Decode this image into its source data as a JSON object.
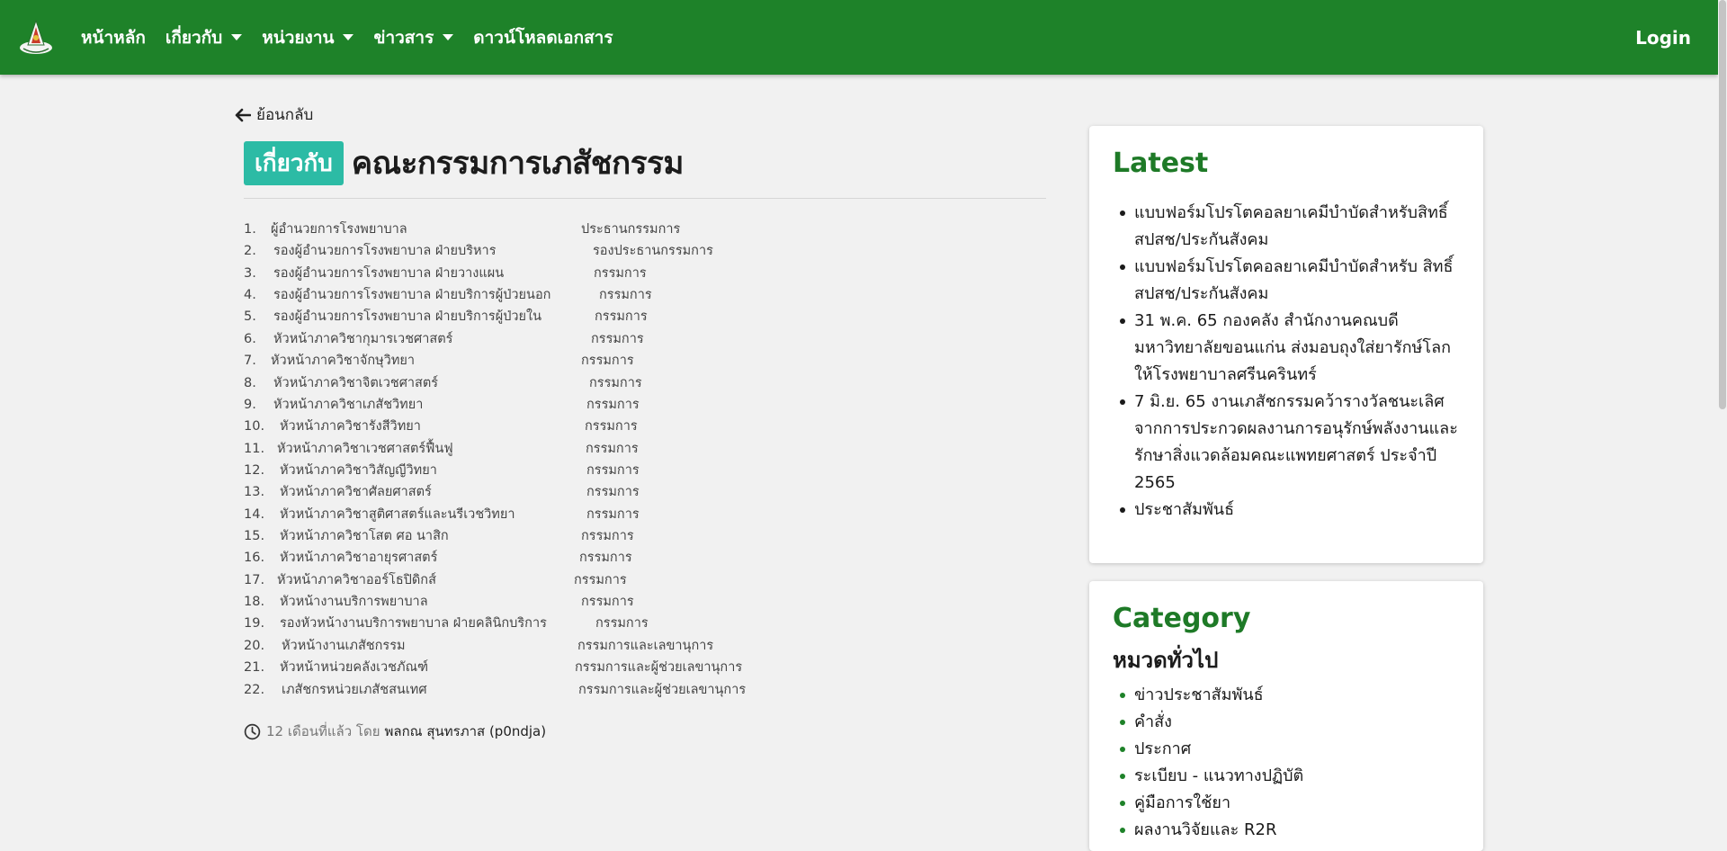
{
  "nav": {
    "home": "หน้าหลัก",
    "about": "เกี่ยวกับ",
    "units": "หน่วยงาน",
    "news": "ข่าวสาร",
    "downloads": "ดาวน์โหลดเอกสาร",
    "login": "Login"
  },
  "back_label": "ย้อนกลับ",
  "badge": "เกี่ยวกับ",
  "page_title": "คณะกรรมการเภสัชกรรม",
  "members": [
    {
      "num": "1.",
      "name": "ผู้อำนวยการโรงพยาบาล",
      "role": "ประธานกรรมการ"
    },
    {
      "num": "2.",
      "name": "รองผู้อำนวยการโรงพยาบาล ฝ่ายบริหาร",
      "role": "รองประธานกรรมการ"
    },
    {
      "num": "3.",
      "name": "รองผู้อำนวยการโรงพยาบาล ฝ่ายวางแผน",
      "role": "กรรมการ"
    },
    {
      "num": "4.",
      "name": "รองผู้อำนวยการโรงพยาบาล ฝ่ายบริการผู้ป่วยนอก",
      "role": "กรรมการ"
    },
    {
      "num": "5.",
      "name": "รองผู้อำนวยการโรงพยาบาล ฝ่ายบริการผู้ป่วยใน",
      "role": "กรรมการ"
    },
    {
      "num": "6.",
      "name": "หัวหน้าภาควิชากุมารเวชศาสตร์",
      "role": "กรรมการ"
    },
    {
      "num": "7.",
      "name": "หัวหน้าภาควิชาจักษุวิทยา",
      "role": "กรรมการ"
    },
    {
      "num": "8.",
      "name": "หัวหน้าภาควิชาจิตเวชศาสตร์",
      "role": "กรรมการ"
    },
    {
      "num": "9.",
      "name": "หัวหน้าภาควิชาเภสัชวิทยา",
      "role": "กรรมการ"
    },
    {
      "num": "10.",
      "name": "หัวหน้าภาควิชารังสีวิทยา",
      "role": "กรรมการ"
    },
    {
      "num": "11.",
      "name": "หัวหน้าภาควิชาเวชศาสตร์ฟื้นฟู",
      "role": "กรรมการ"
    },
    {
      "num": "12.",
      "name": "หัวหน้าภาควิชาวิสัญญีวิทยา",
      "role": "กรรมการ"
    },
    {
      "num": "13.",
      "name": "หัวหน้าภาควิชาศัลยศาสตร์",
      "role": "กรรมการ"
    },
    {
      "num": "14.",
      "name": "หัวหน้าภาควิชาสูติศาสตร์และนรีเวชวิทยา",
      "role": "กรรมการ"
    },
    {
      "num": "15.",
      "name": "หัวหน้าภาควิชาโสต ศอ นาสิก",
      "role": "กรรมการ"
    },
    {
      "num": "16.",
      "name": "หัวหน้าภาควิชาอายุรศาสตร์",
      "role": "กรรมการ"
    },
    {
      "num": "17.",
      "name": "หัวหน้าภาควิชาออร์โธปิดิกส์",
      "role": "กรรมการ"
    },
    {
      "num": "18.",
      "name": "หัวหน้างานบริการพยาบาล",
      "role": "กรรมการ"
    },
    {
      "num": "19.",
      "name": "รองหัวหน้างานบริการพยาบาล ฝ่ายคลินิกบริการ",
      "role": "กรรมการ"
    },
    {
      "num": "20.",
      "name": "หัวหน้างานเภสัชกรรม",
      "role": "กรรมการและเลขานุการ"
    },
    {
      "num": "21.",
      "name": "หัวหน้าหน่วยคลังเวชภัณฑ์",
      "role": "กรรมการและผู้ช่วยเลขานุการ"
    },
    {
      "num": "22.",
      "name": "เภสัชกรหน่วยเภสัชสนเทศ",
      "role": "กรรมการและผู้ช่วยเลขานุการ"
    }
  ],
  "meta": {
    "time": "12 เดือนที่แล้ว โดย",
    "author": "พลกณ สุนทรภาส (p0ndja)"
  },
  "latest": {
    "title": "Latest",
    "items": [
      "แบบฟอร์มโปรโตคอลยาเคมีบำบัดสำหรับสิทธิ์สปสช/ประกันสังคม",
      "แบบฟอร์มโปรโตคอลยาเคมีบำบัดสำหรับ สิทธิ์ สปสช/ประกันสังคม",
      "31 พ.ค. 65 กองคลัง สำนักงานคณบดี มหาวิทยาลัยขอนแก่น ส่งมอบถุงใส่ยารักษ์โลกให้โรงพยาบาลศรีนครินทร์",
      "7 มิ.ย. 65 งานเภสัชกรรมคว้ารางวัลชนะเลิศจากการประกวดผลงานการอนุรักษ์พลังงานและรักษาสิ่งแวดล้อมคณะแพทยศาสตร์ ประจำปี 2565",
      "ประชาสัมพันธ์"
    ]
  },
  "category": {
    "title": "Category",
    "subtitle": "หมวดทั่วไป",
    "items": [
      "ข่าวประชาสัมพันธ์",
      "คำสั่ง",
      "ประกาศ",
      "ระเบียบ - แนวทางปฏิบัติ",
      "คู่มือการใช้ยา",
      "ผลงานวิจัยและ R2R"
    ]
  },
  "colors": {
    "navbar": "#1e8229",
    "badge": "#2cbba5",
    "card_title": "#1e7a27"
  }
}
